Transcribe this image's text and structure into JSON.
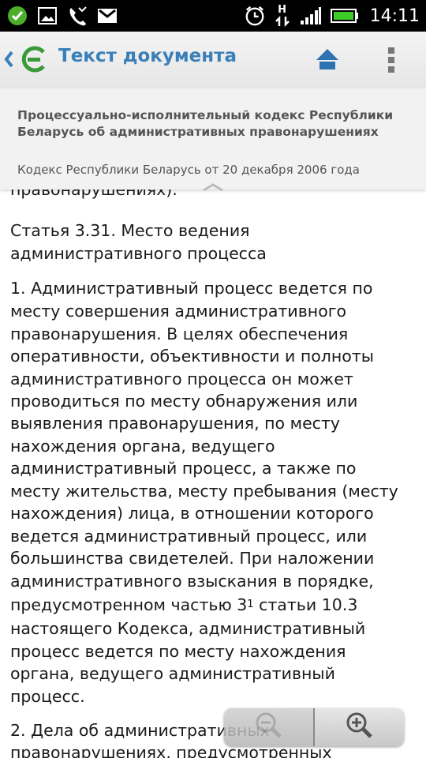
{
  "status_bar": {
    "time": "14:11",
    "network_label": "H",
    "icons": [
      "check-circle-icon",
      "image-icon",
      "missed-call-icon",
      "gmail-icon",
      "alarm-icon",
      "data-transfer-icon",
      "signal-icon",
      "battery-icon"
    ]
  },
  "action_bar": {
    "title": "Текст документа",
    "accent_color": "#3a7fb8",
    "icons": [
      "back-chevron-icon",
      "app-logo-icon",
      "home-up-icon",
      "overflow-menu-icon"
    ]
  },
  "document": {
    "title": "Процессуально-исполнительный кодекс Республики Беларусь об административных правонарушениях",
    "subtitle": "Кодекс Республики Беларусь от 20 декабря 2006 года"
  },
  "body": {
    "partial_top": "правонарушениях).",
    "article_heading": [
      "Статья 3.31. Место ведения",
      "административного процесса"
    ],
    "paragraph1": [
      "1. Административный процесс ведется по",
      "месту совершения административного",
      "правонарушения. В целях обеспечения",
      "оперативности, объективности и полноты",
      "административного процесса он может",
      "проводиться по месту обнаружения или",
      "выявления правонарушения, по месту",
      "нахождения органа, ведущего",
      "административный процесс, а также по",
      "месту жительства, месту пребывания (месту",
      "нахождения) лица, в отношении которого",
      "ведется административный процесс, или",
      "большинства свидетелей. При наложении",
      "административного взыскания в порядке,"
    ],
    "para1_sup_line_before": "предусмотренном частью 3",
    "para1_sup": "1",
    "para1_sup_line_after": " статьи 10.3",
    "paragraph1_end": [
      "настоящего Кодекса, административный",
      "процесс ведется по месту нахождения",
      "органа, ведущего административный",
      "процесс."
    ],
    "paragraph2": [
      "2. Дела об административных",
      "правонарушениях, предусмотренных"
    ]
  },
  "zoom": {
    "icons": [
      "zoom-out-icon",
      "zoom-in-icon"
    ]
  }
}
